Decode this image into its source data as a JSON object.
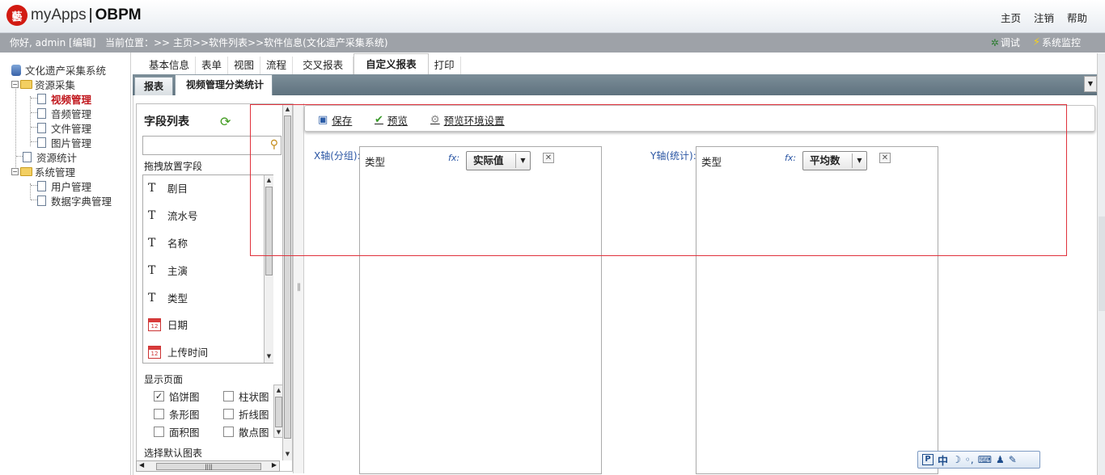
{
  "app": {
    "brand": "myApps",
    "product": "OBPM"
  },
  "top_links": [
    "主页",
    "注销",
    "帮助"
  ],
  "status": {
    "greeting": "你好, admin [编辑]",
    "breadcrumb": "当前位置：>> 主页>>软件列表>>软件信息(文化遗产采集系统)",
    "debug_label": "调试",
    "monitor_label": "系统监控"
  },
  "tree": {
    "root": "文化遗产采集系统",
    "group1": "资源采集",
    "items1": [
      "视频管理",
      "音频管理",
      "文件管理",
      "图片管理"
    ],
    "stats": "资源统计",
    "group2": "系统管理",
    "items2": [
      "用户管理",
      "数据字典管理"
    ]
  },
  "tabs_primary": [
    "基本信息",
    "表单",
    "视图",
    "流程",
    "交叉报表",
    "自定义报表",
    "打印"
  ],
  "tabs_primary_active": "自定义报表",
  "tabs_secondary": [
    "报表",
    "视频管理分类统计"
  ],
  "field_panel": {
    "title": "字段列表",
    "search_placeholder": "",
    "drag_label": "拖拽放置字段",
    "fields": [
      {
        "type": "text",
        "name": "剧目"
      },
      {
        "type": "text",
        "name": "流水号"
      },
      {
        "type": "text",
        "name": "名称"
      },
      {
        "type": "text",
        "name": "主演"
      },
      {
        "type": "text",
        "name": "类型"
      },
      {
        "type": "date",
        "name": "日期"
      },
      {
        "type": "date",
        "name": "上传时间"
      }
    ],
    "display_label": "显示页面",
    "charts": [
      {
        "name": "馅饼图",
        "checked": true
      },
      {
        "name": "柱状图",
        "checked": false
      },
      {
        "name": "条形图",
        "checked": false
      },
      {
        "name": "折线图",
        "checked": false
      },
      {
        "name": "面积图",
        "checked": false
      },
      {
        "name": "散点图",
        "checked": false
      }
    ],
    "default_chart_label": "选择默认图表"
  },
  "toolbar": {
    "save": "保存",
    "preview": "预览",
    "preview_settings": "预览环境设置"
  },
  "x_axis": {
    "label": "X轴(分组):",
    "field": "类型",
    "fx": "fx:",
    "func": "实际值"
  },
  "y_axis": {
    "label": "Y轴(统计):",
    "field": "类型",
    "fx": "fx:",
    "func": "平均数"
  },
  "ime": {
    "mode": "中"
  },
  "colors": {
    "status_bar": "#9ea2a8",
    "tab_band": "#6b7f8a",
    "highlight": "#e0323c",
    "active_tree": "#c0161c"
  }
}
